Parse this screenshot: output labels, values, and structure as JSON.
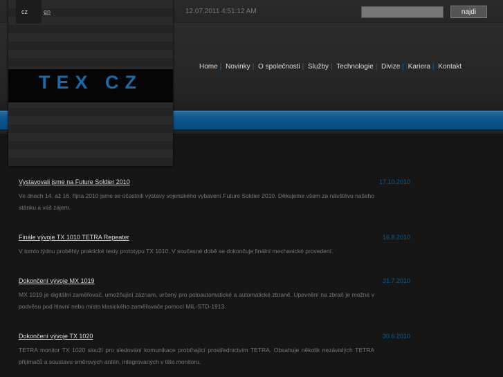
{
  "header": {
    "lang_cz": "cz",
    "lang_en": "en",
    "datetime": "12.07.2011 4:51:12 AM",
    "search_placeholder": "",
    "search_button": "najdi"
  },
  "logo": {
    "text": "TEX CZ"
  },
  "nav": [
    "Home",
    "Novinky",
    "O společnosti",
    "Služby",
    "Technologie",
    "Divize",
    "Kariera",
    "Kontakt"
  ],
  "news": [
    {
      "title": "Vystavovali jsme na Future Soldier 2010",
      "date": "17.10.2010",
      "body": "Ve dnech 14. až 16. října 2010 jsme se účastnili výstavy vojenského vybavení Future Soldier 2010. Děkujeme všem za návštěvu našeho stánku a váš zájem."
    },
    {
      "title": "Finále vývoje TX 1010 TETRA Repeater",
      "date": "16.8.2010",
      "body": "V tomto týdnu proběhly praktické testy prototypu TX 1010. V současné době se dokončuje finální mechanické provedení."
    },
    {
      "title": "Dokončení vývoje MX 1019",
      "date": "31.7.2010",
      "body": "MX 1019 je digitální zaměřovač, umožňující záznam, určený pro poloautomatické a automatické zbraně. Upevnění na zbraň je možné v podvěsu pod hlavní nebo místo klasického zaměřovače pomocí MIL-STD-1913."
    },
    {
      "title": "Dokončení vývoje TX 1020",
      "date": "30.6.2010",
      "body": "TETRA monitor TX 1020 slouží pro sledování komunikace probíhající prostřednictvím TETRA. Obsahuje několik nezávislých TETRA přijímačů a soustavu směrových antén, integrovaných v těle monitoru."
    }
  ]
}
